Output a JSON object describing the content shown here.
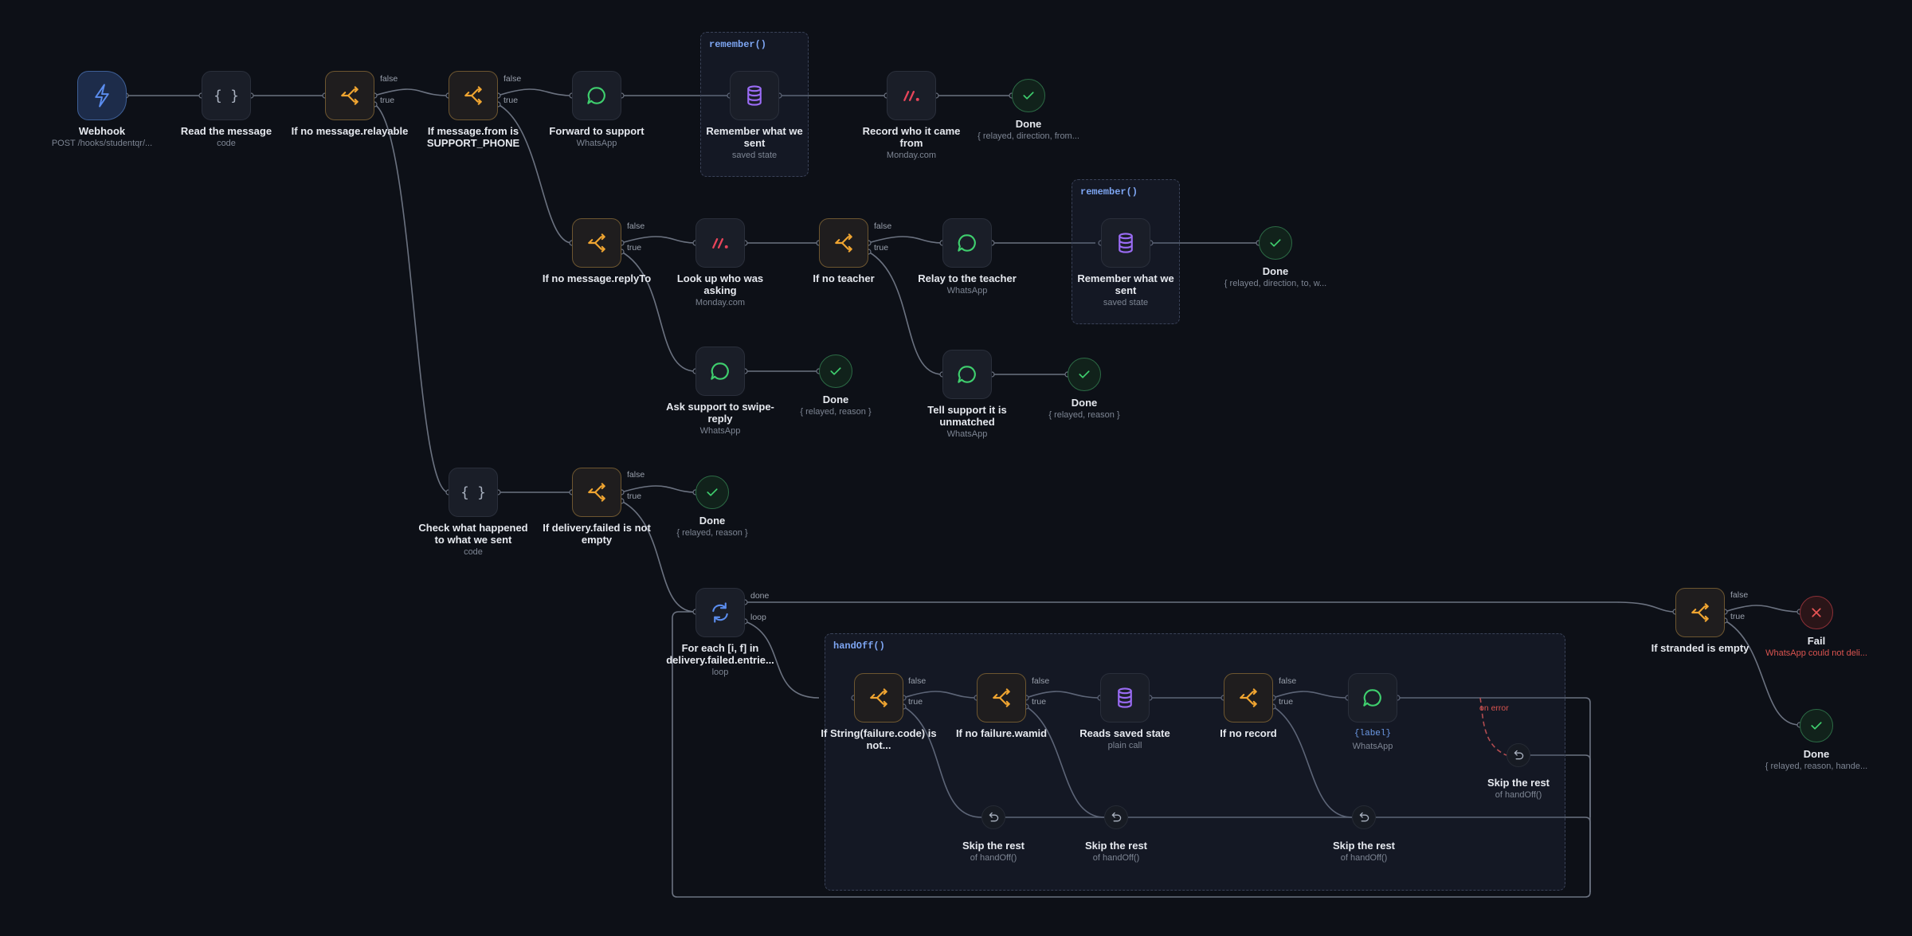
{
  "groups": {
    "remember1": "remember()",
    "remember2": "remember()",
    "handoff": "handOff()"
  },
  "ports": {
    "false": "false",
    "true": "true",
    "done": "done",
    "loop": "loop",
    "on_error": "on error"
  },
  "nodes": {
    "webhook": {
      "title": "Webhook",
      "sub": "POST /hooks/studentqr/...",
      "icon": "bolt-icon"
    },
    "read": {
      "title": "Read the message",
      "sub": "code",
      "icon": "braces-icon"
    },
    "if_relayable": {
      "title": "If no message.relayable",
      "icon": "branch-icon"
    },
    "if_from": {
      "title": "If message.from is SUPPORT_PHONE",
      "icon": "branch-icon"
    },
    "forward": {
      "title": "Forward to support",
      "sub": "WhatsApp",
      "icon": "chat-icon"
    },
    "remember1": {
      "title": "Remember what we sent",
      "sub": "saved state",
      "icon": "database-icon"
    },
    "record": {
      "title": "Record who it came from",
      "sub": "Monday.com",
      "icon": "monday-icon"
    },
    "done1": {
      "title": "Done",
      "sub": "{ relayed, direction, from..."
    },
    "if_replyto": {
      "title": "If no message.replyTo",
      "icon": "branch-icon"
    },
    "lookup": {
      "title": "Look up who was asking",
      "sub": "Monday.com",
      "icon": "monday-icon"
    },
    "if_teacher": {
      "title": "If no teacher",
      "icon": "branch-icon"
    },
    "relay": {
      "title": "Relay to the teacher",
      "sub": "WhatsApp",
      "icon": "chat-icon"
    },
    "remember2": {
      "title": "Remember what we sent",
      "sub": "saved state",
      "icon": "database-icon"
    },
    "done2": {
      "title": "Done",
      "sub": "{ relayed, direction, to, w..."
    },
    "ask": {
      "title": "Ask support to swipe-reply",
      "sub": "WhatsApp",
      "icon": "chat-icon"
    },
    "done3": {
      "title": "Done",
      "sub": "{ relayed, reason }"
    },
    "tell": {
      "title": "Tell support it is unmatched",
      "sub": "WhatsApp",
      "icon": "chat-icon"
    },
    "done4": {
      "title": "Done",
      "sub": "{ relayed, reason }"
    },
    "check": {
      "title": "Check what happened to what we sent",
      "sub": "code",
      "icon": "braces-icon"
    },
    "if_failed": {
      "title": "If delivery.failed is not empty",
      "icon": "branch-icon"
    },
    "done5": {
      "title": "Done",
      "sub": "{ relayed, reason }"
    },
    "foreach": {
      "title": "For each [i, f] in delivery.failed.entrie...",
      "sub": "loop",
      "icon": "loop-icon"
    },
    "if_code": {
      "title": "If String(failure.code) is not...",
      "icon": "branch-icon"
    },
    "if_wamid": {
      "title": "If no failure.wamid",
      "icon": "branch-icon"
    },
    "reads": {
      "title": "Reads saved state",
      "sub": "plain call",
      "icon": "database-icon"
    },
    "if_record": {
      "title": "If no record",
      "icon": "branch-icon"
    },
    "label_node": {
      "title": "",
      "sub": "{label}",
      "sub2": "WhatsApp",
      "icon": "chat-icon"
    },
    "skip1": {
      "title": "Skip the rest",
      "sub": "of handOff()",
      "icon": "undo-icon"
    },
    "skip2": {
      "title": "Skip the rest",
      "sub": "of handOff()",
      "icon": "undo-icon"
    },
    "skip3": {
      "title": "Skip the rest",
      "sub": "of handOff()",
      "icon": "undo-icon"
    },
    "skip4": {
      "title": "Skip the rest",
      "sub": "of handOff()",
      "icon": "undo-icon"
    },
    "if_stranded": {
      "title": "If stranded is empty",
      "icon": "branch-icon"
    },
    "fail": {
      "title": "Fail",
      "sub": "WhatsApp could not deli..."
    },
    "done6": {
      "title": "Done",
      "sub": "{ relayed, reason, hande..."
    }
  },
  "colors": {
    "background": "#0d1017",
    "edge": "#6b7280",
    "branch": "#f0a531",
    "chat": "#3fcf6e",
    "database": "#9b6cf5",
    "monday": "#e8455a",
    "done": "#3fcf6e",
    "fail": "#e85555",
    "trigger": "#5b8def",
    "error_edge": "#d9534f"
  }
}
